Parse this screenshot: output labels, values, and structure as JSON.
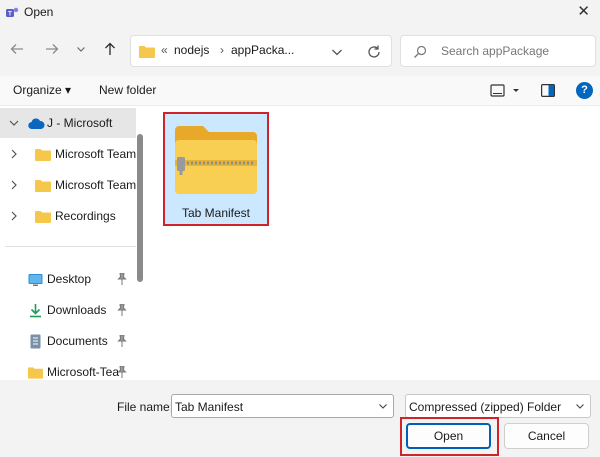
{
  "window": {
    "title": "Open",
    "app_icon": "teams-icon",
    "close_glyph": "✕"
  },
  "nav": {
    "back_icon": "arrow-left-icon",
    "forward_icon": "arrow-right-icon",
    "recent_icon": "chevron-down-icon",
    "up_icon": "arrow-up-icon"
  },
  "address": {
    "overflow": "«",
    "crumbs": [
      "nodejs",
      "appPacka..."
    ],
    "separator": "›",
    "refresh_icon": "refresh-icon"
  },
  "search": {
    "placeholder": "Search appPackage"
  },
  "toolbar": {
    "organize": "Organize ▾",
    "new_folder": "New folder",
    "help": "?"
  },
  "sidebar": {
    "items": [
      {
        "label": "J - Microsoft",
        "icon": "onedrive-icon",
        "selected": true
      },
      {
        "label": "Microsoft Team",
        "icon": "folder-icon"
      },
      {
        "label": "Microsoft Team",
        "icon": "folder-icon"
      },
      {
        "label": "Recordings",
        "icon": "folder-icon"
      }
    ],
    "quick": [
      {
        "label": "Desktop",
        "icon": "desktop-icon",
        "pinned": true
      },
      {
        "label": "Downloads",
        "icon": "download-icon",
        "pinned": true
      },
      {
        "label": "Documents",
        "icon": "documents-icon",
        "pinned": true
      },
      {
        "label": "Microsoft-Tea",
        "icon": "folder-icon",
        "pinned": true
      }
    ]
  },
  "files": [
    {
      "name": "Tab Manifest",
      "type": "zip-folder-icon",
      "selected": true
    }
  ],
  "footer": {
    "file_name_label": "File name:",
    "file_name_value": "Tab Manifest",
    "file_type": "Compressed (zipped) Folder",
    "open_label": "Open",
    "cancel_label": "Cancel"
  },
  "colors": {
    "accent": "#0067c0",
    "highlight_outline": "#d0242b",
    "selection": "#cce8ff",
    "folder": "#f5c74a"
  }
}
